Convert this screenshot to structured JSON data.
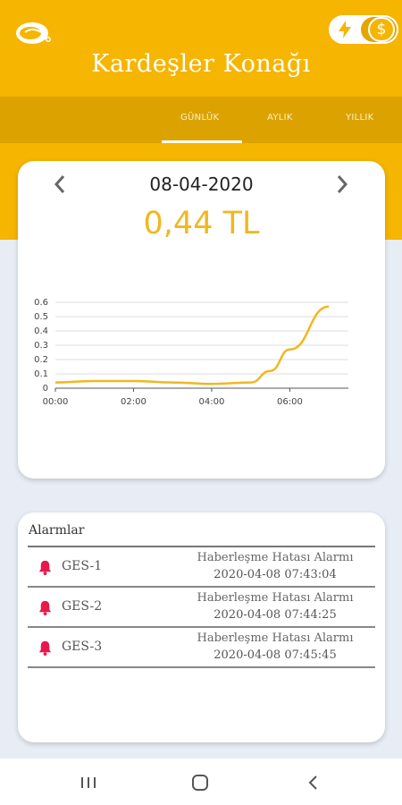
{
  "app": {
    "title": "Kardeşler Konağı"
  },
  "toggle": {
    "left_icon": "lightning-icon",
    "right_icon": "dollar-icon",
    "right_symbol": "$",
    "active": "right"
  },
  "tabs": [
    {
      "label": "GÜNLÜK",
      "active": true
    },
    {
      "label": "AYLIK",
      "active": false
    },
    {
      "label": "YILLIK",
      "active": false
    }
  ],
  "summary": {
    "date": "08-04-2020",
    "amount": "0,44 TL"
  },
  "chart_data": {
    "type": "line",
    "x": [
      "00:00",
      "01:00",
      "02:00",
      "03:00",
      "04:00",
      "05:00",
      "05:30",
      "06:00",
      "07:00"
    ],
    "values": [
      0.04,
      0.05,
      0.05,
      0.04,
      0.03,
      0.04,
      0.12,
      0.27,
      0.57
    ],
    "x_ticks": [
      "00:00",
      "02:00",
      "04:00",
      "06:00"
    ],
    "y_ticks": [
      "0",
      "0.1",
      "0.2",
      "0.3",
      "0.4",
      "0.5",
      "0.6"
    ],
    "ylim": [
      0,
      0.6
    ],
    "xlim": [
      0,
      7.5
    ],
    "line_color": "#f0b820",
    "grid": true
  },
  "alarms": {
    "title": "Alarmlar",
    "items": [
      {
        "device": "GES-1",
        "message": "Haberleşme Hatası Alarmı",
        "time": "2020-04-08 07:43:04"
      },
      {
        "device": "GES-2",
        "message": "Haberleşme Hatası Alarmı",
        "time": "2020-04-08 07:44:25"
      },
      {
        "device": "GES-3",
        "message": "Haberleşme Hatası Alarmı",
        "time": "2020-04-08 07:45:45"
      }
    ]
  },
  "colors": {
    "brand": "#f5b500",
    "tab_bar": "#dca200",
    "alarm_bell": "#e8194a"
  }
}
